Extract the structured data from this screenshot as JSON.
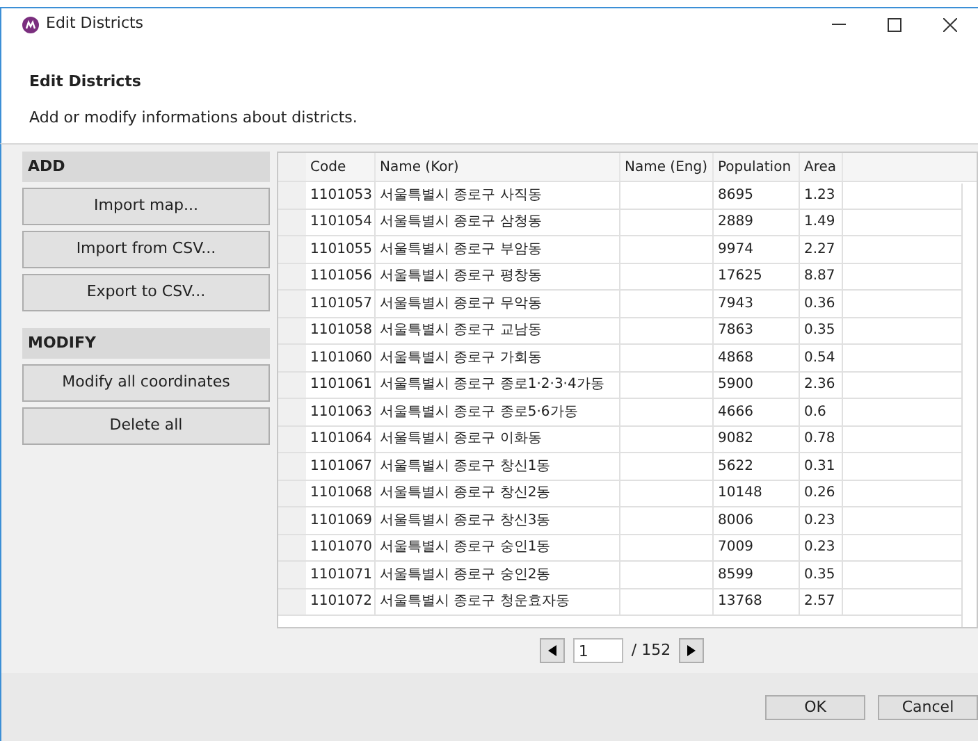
{
  "window": {
    "title": "Edit Districts"
  },
  "header": {
    "title": "Edit Districts",
    "subtitle": "Add or modify informations about districts."
  },
  "sections": [
    {
      "title": "ADD",
      "buttons": [
        "Import map...",
        "Import from CSV...",
        "Export to CSV..."
      ]
    },
    {
      "title": "MODIFY",
      "buttons": [
        "Modify all coordinates",
        "Delete all"
      ]
    }
  ],
  "table": {
    "columns": [
      "Code",
      "Name (Kor)",
      "Name (Eng)",
      "Population",
      "Area"
    ],
    "rows": [
      [
        "1101053",
        "서울특별시 종로구 사직동",
        "",
        "8695",
        "1.23"
      ],
      [
        "1101054",
        "서울특별시 종로구 삼청동",
        "",
        "2889",
        "1.49"
      ],
      [
        "1101055",
        "서울특별시 종로구 부암동",
        "",
        "9974",
        "2.27"
      ],
      [
        "1101056",
        "서울특별시 종로구 평창동",
        "",
        "17625",
        "8.87"
      ],
      [
        "1101057",
        "서울특별시 종로구 무악동",
        "",
        "7943",
        "0.36"
      ],
      [
        "1101058",
        "서울특별시 종로구 교남동",
        "",
        "7863",
        "0.35"
      ],
      [
        "1101060",
        "서울특별시 종로구 가회동",
        "",
        "4868",
        "0.54"
      ],
      [
        "1101061",
        "서울특별시 종로구 종로1·2·3·4가동",
        "",
        "5900",
        "2.36"
      ],
      [
        "1101063",
        "서울특별시 종로구 종로5·6가동",
        "",
        "4666",
        "0.6"
      ],
      [
        "1101064",
        "서울특별시 종로구 이화동",
        "",
        "9082",
        "0.78"
      ],
      [
        "1101067",
        "서울특별시 종로구 창신1동",
        "",
        "5622",
        "0.31"
      ],
      [
        "1101068",
        "서울특별시 종로구 창신2동",
        "",
        "10148",
        "0.26"
      ],
      [
        "1101069",
        "서울특별시 종로구 창신3동",
        "",
        "8006",
        "0.23"
      ],
      [
        "1101070",
        "서울특별시 종로구 숭인1동",
        "",
        "7009",
        "0.23"
      ],
      [
        "1101071",
        "서울특별시 종로구 숭인2동",
        "",
        "8599",
        "0.35"
      ],
      [
        "1101072",
        "서울특별시 종로구 청운효자동",
        "",
        "13768",
        "2.57"
      ]
    ]
  },
  "pagination": {
    "page": "1",
    "total": "/ 152"
  },
  "buttons": [
    "OK",
    "Cancel"
  ]
}
